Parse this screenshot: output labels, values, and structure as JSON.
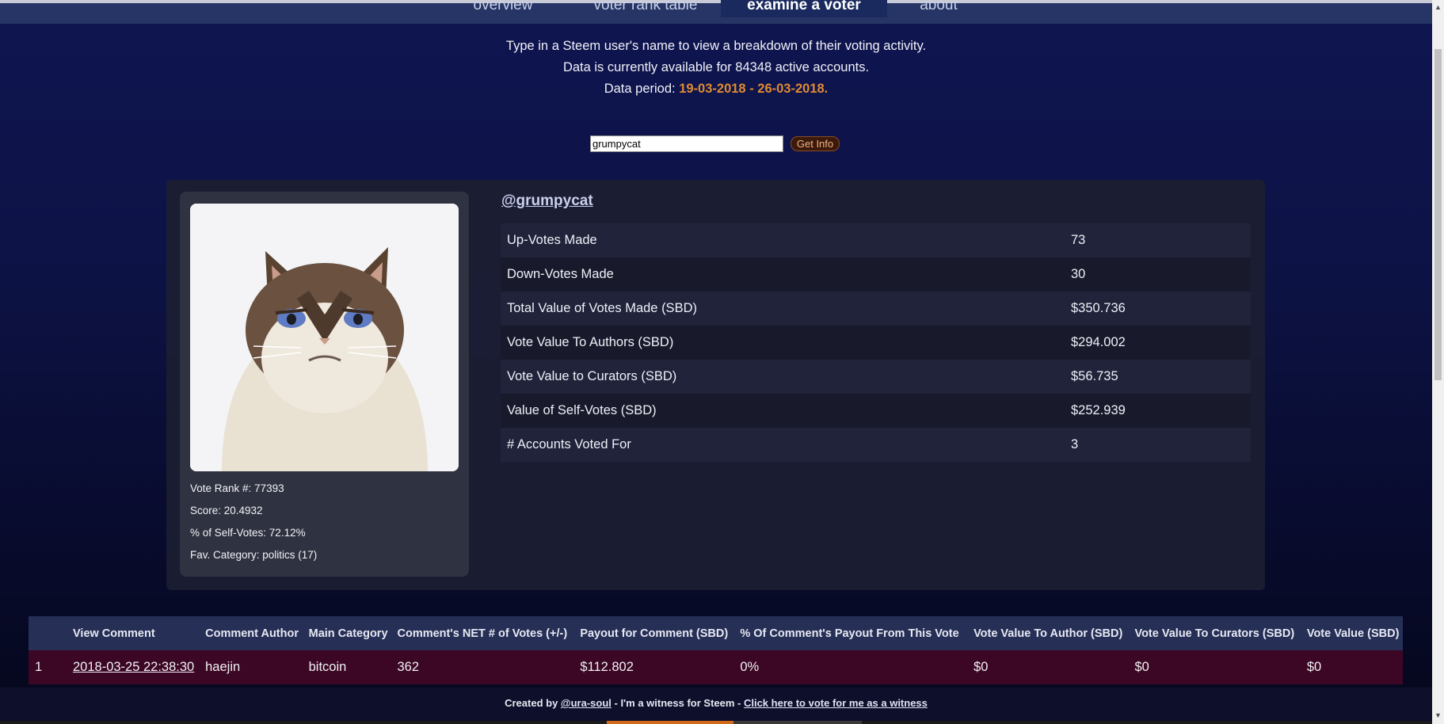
{
  "nav": {
    "tabs": [
      "overview",
      "voter rank table",
      "examine a voter",
      "about"
    ],
    "active_tab": "examine a voter"
  },
  "intro": {
    "line1": "Type in a Steem user's name to view a breakdown of their voting activity.",
    "line2": "Data is currently available for 84348 active accounts.",
    "line3_prefix": "Data period: ",
    "line3_period": "19-03-2018 - 26-03-2018."
  },
  "search": {
    "value": "grumpycat",
    "button_label": "Get Info"
  },
  "profile": {
    "vote_rank": "Vote Rank #: 77393",
    "score": "Score: 20.4932",
    "self_votes": "% of Self-Votes: 72.12%",
    "fav_category": "Fav. Category: politics (17)"
  },
  "voter": {
    "username": "@grumpycat",
    "stats": [
      {
        "label": "Up-Votes Made",
        "value": "73"
      },
      {
        "label": "Down-Votes Made",
        "value": "30"
      },
      {
        "label": "Total Value of Votes Made (SBD)",
        "value": "$350.736"
      },
      {
        "label": "Vote Value To Authors (SBD)",
        "value": "$294.002"
      },
      {
        "label": "Vote Value to Curators (SBD)",
        "value": "$56.735"
      },
      {
        "label": "Value of Self-Votes (SBD)",
        "value": "$252.939"
      },
      {
        "label": "# Accounts Voted For",
        "value": "3"
      }
    ]
  },
  "votes_table": {
    "headers": [
      "",
      "View Comment",
      "Comment Author",
      "Main Category",
      "Comment's NET # of Votes (+/-)",
      "Payout for Comment (SBD)",
      "% Of Comment's Payout From This Vote",
      "Vote Value To Author (SBD)",
      "Vote Value To Curators (SBD)",
      "Vote Value (SBD)"
    ],
    "rows": [
      [
        "1",
        "2018-03-25 22:38:30",
        "haejin",
        "bitcoin",
        "362",
        "$112.802",
        "0%",
        "$0",
        "$0",
        "$0"
      ]
    ]
  },
  "footer": {
    "created_by": "Created by ",
    "author": "@ura-soul",
    "middle": " - I'm a witness for Steem - ",
    "witness_link": "Click here to vote for me as a witness"
  },
  "colors": {
    "accent_orange": "#e08a34",
    "nav_bg": "#263565",
    "row_bg": "#3c0724"
  }
}
